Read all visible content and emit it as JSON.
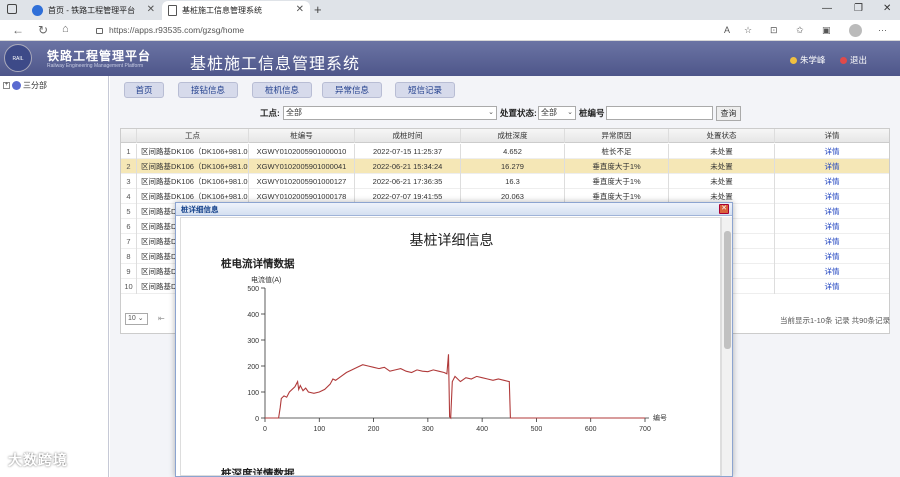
{
  "browser": {
    "tabs": [
      {
        "label": "首页 - 铁路工程管理平台",
        "active": false
      },
      {
        "label": "基桩施工信息管理系统",
        "active": true
      }
    ],
    "url": "https://apps.r93535.com/gzsg/home"
  },
  "header": {
    "system_name": "铁路工程管理平台",
    "system_name_en": "Railway Engineering Management Platform",
    "app_title": "基桩施工信息管理系统",
    "user_name": "朱学峰",
    "logout_label": "退出"
  },
  "sidebar": {
    "tree_root": "三分部"
  },
  "nav": {
    "home": "首页",
    "pile_driving": "接钻信息",
    "pile_machine": "桩机信息",
    "abnormal": "异常信息",
    "sms": "短信记录"
  },
  "filters": {
    "site_label": "工点:",
    "site_value": "全部",
    "status_label": "处置状态:",
    "status_value": "全部",
    "pile_no_label": "桩编号",
    "query_label": "查询"
  },
  "table": {
    "headers": [
      "工点",
      "桩编号",
      "成桩时间",
      "成桩深度",
      "异常原因",
      "处置状态",
      "详情"
    ],
    "rows": [
      {
        "n": "1",
        "site": "区间路基DK106（DK106+981.0(",
        "pile": "XGWY0102005901000010",
        "time": "2022-07-15 11:25:37",
        "depth": "4.652",
        "reason": "桩长不足",
        "status": "未处置",
        "detail": "详情"
      },
      {
        "n": "2",
        "site": "区间路基DK106（DK106+981.0(",
        "pile": "XGWY0102005901000041",
        "time": "2022-06-21 15:34:24",
        "depth": "16.279",
        "reason": "垂直度大于1%",
        "status": "未处置",
        "detail": "详情"
      },
      {
        "n": "3",
        "site": "区间路基DK106（DK106+981.0(",
        "pile": "XGWY0102005901000127",
        "time": "2022-06-21 17:36:35",
        "depth": "16.3",
        "reason": "垂直度大于1%",
        "status": "未处置",
        "detail": "详情"
      },
      {
        "n": "4",
        "site": "区间路基DK106（DK106+981.0(",
        "pile": "XGWY0102005901000178",
        "time": "2022-07-07 19:41:55",
        "depth": "20.063",
        "reason": "垂直度大于1%",
        "status": "未处置",
        "detail": "详情"
      },
      {
        "n": "5",
        "site": "区间路基DK",
        "detail": "详情"
      },
      {
        "n": "6",
        "site": "区间路基DK",
        "detail": "详情"
      },
      {
        "n": "7",
        "site": "区间路基DK",
        "detail": "详情"
      },
      {
        "n": "8",
        "site": "区间路基DK",
        "detail": "详情"
      },
      {
        "n": "9",
        "site": "区间路基DK",
        "detail": "详情"
      },
      {
        "n": "10",
        "site": "区间路基DK",
        "detail": "详情"
      }
    ]
  },
  "pager": {
    "page_size": "10",
    "info": "当前显示1-10条 记录 共90条记录"
  },
  "modal": {
    "title": "桩详细信息",
    "heading": "基桩详细信息",
    "section1": "桩电流详情数据",
    "section2": "桩深度详情数据"
  },
  "watermark": "大数跨境",
  "chart_data": {
    "type": "line",
    "title": "",
    "ylabel": "电流值(A)",
    "xlabel": "编号",
    "xlim": [
      0,
      700
    ],
    "ylim": [
      0,
      500
    ],
    "xticks": [
      "0",
      "100",
      "200",
      "300",
      "400",
      "500",
      "600",
      "700"
    ],
    "yticks": [
      "0",
      "100",
      "200",
      "300",
      "400",
      "500"
    ],
    "color": "#b03a3a",
    "series": [
      {
        "x": [
          0,
          25,
          28,
          30,
          35,
          40,
          45,
          55,
          60,
          62,
          65,
          70,
          75,
          80,
          90,
          100,
          110,
          120,
          125,
          130,
          140,
          150,
          160,
          170,
          180,
          190,
          200,
          210,
          220,
          230,
          240,
          250,
          260,
          270,
          280,
          290,
          300,
          310,
          320,
          330,
          335,
          338,
          340,
          342,
          345,
          350,
          355,
          360,
          370,
          380,
          390,
          400,
          410,
          420,
          430,
          440,
          450,
          452,
          455,
          500,
          600,
          700
        ],
        "y": [
          0,
          0,
          40,
          75,
          85,
          80,
          100,
          120,
          140,
          110,
          125,
          105,
          115,
          100,
          95,
          100,
          110,
          130,
          150,
          145,
          160,
          175,
          185,
          195,
          205,
          200,
          195,
          190,
          195,
          180,
          185,
          190,
          180,
          175,
          185,
          180,
          178,
          185,
          180,
          175,
          170,
          245,
          5,
          0,
          140,
          160,
          150,
          140,
          155,
          150,
          160,
          155,
          150,
          145,
          150,
          145,
          140,
          0,
          0,
          0,
          0,
          0
        ]
      }
    ]
  }
}
